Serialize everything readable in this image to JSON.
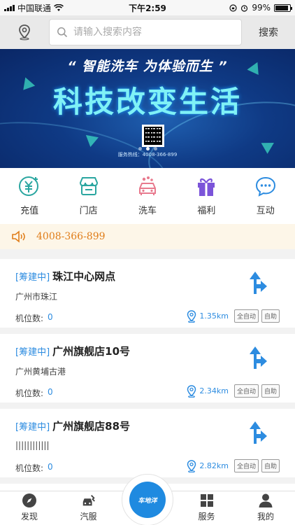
{
  "status_bar": {
    "carrier": "中国联通",
    "time": "下午2:59",
    "battery": "99%"
  },
  "header": {
    "search_placeholder": "请输入搜索内容",
    "search_button": "搜索",
    "location_icon": "location-pin-icon"
  },
  "banner": {
    "slogan": "“ 智能洗车  为体验而生 ”",
    "title": "科技改变生活",
    "hotline": "服务热线：4008-366-899",
    "slide_count": 3,
    "active_slide": 1
  },
  "quick_menu": [
    {
      "label": "充值",
      "icon": "recharge-icon",
      "color": "#2aa6a0"
    },
    {
      "label": "门店",
      "icon": "store-icon",
      "color": "#2aa6a0"
    },
    {
      "label": "洗车",
      "icon": "car-wash-icon",
      "color": "#e87a8e"
    },
    {
      "label": "福利",
      "icon": "gift-icon",
      "color": "#7b54d9"
    },
    {
      "label": "互动",
      "icon": "chat-icon",
      "color": "#2d8ce0"
    }
  ],
  "notice": {
    "phone": "4008-366-899",
    "icon": "speaker-icon"
  },
  "stores": [
    {
      "tag": "[筹建中]",
      "name": "珠江中心网点",
      "address": "广州市珠江",
      "seats_label": "机位数:",
      "seats": "0",
      "distance": "1.35km",
      "chips": [
        "全自动",
        "自助"
      ]
    },
    {
      "tag": "[筹建中]",
      "name": "广州旗舰店10号",
      "address": "广州黄埔古港",
      "seats_label": "机位数:",
      "seats": "0",
      "distance": "2.34km",
      "chips": [
        "全自动",
        "自助"
      ]
    },
    {
      "tag": "[筹建中]",
      "name": "广州旗舰店88号",
      "address": "||||||||||||",
      "seats_label": "机位数:",
      "seats": "0",
      "distance": "2.82km",
      "chips": [
        "全自动",
        "自助"
      ]
    }
  ],
  "tab_bar": {
    "items": [
      {
        "label": "发现",
        "icon": "compass-icon"
      },
      {
        "label": "汽服",
        "icon": "car-service-icon"
      },
      {
        "label": "服务",
        "icon": "grid-icon"
      },
      {
        "label": "我的",
        "icon": "user-icon"
      }
    ],
    "center_label": "车地洋"
  },
  "colors": {
    "accent": "#2d8ce0",
    "notice_text": "#e07d19",
    "banner_title": "#7ff1f6"
  }
}
